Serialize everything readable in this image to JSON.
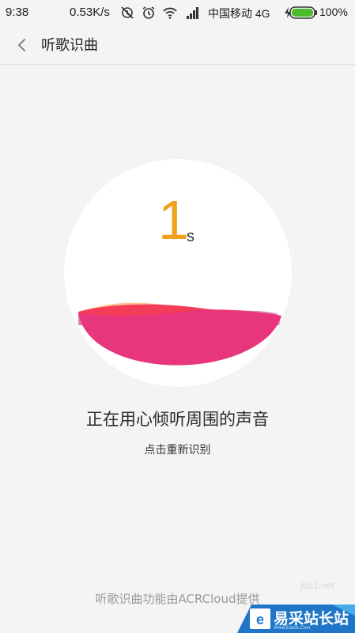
{
  "status_bar": {
    "time": "9:38",
    "net_speed": "0.53K/s",
    "carrier": "中国移动 4G",
    "battery_pct": "100%"
  },
  "header": {
    "title": "听歌识曲",
    "back_icon": "chevron-left-icon"
  },
  "recognizer": {
    "countdown_value": "1",
    "countdown_unit": "s",
    "status_text": "正在用心倾听周围的声音",
    "retry_label": "点击重新识别"
  },
  "footer": {
    "credit": "听歌识曲功能由ACRCloud提供"
  },
  "watermark": {
    "url": "jb51.net",
    "name": "易采站长站",
    "sub": "Www.Easck.Com"
  },
  "colors": {
    "accent_orange": "#f0a21c",
    "wave_pink": "#e8367d",
    "wave_red": "#f43c58",
    "wave_purple": "#b455d6",
    "watermark_blue": "#1f76c8"
  }
}
